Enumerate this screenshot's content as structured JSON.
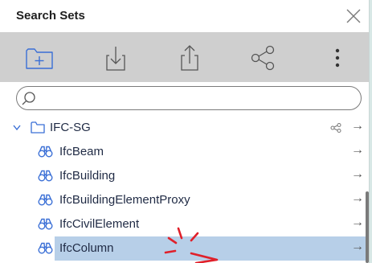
{
  "window": {
    "title": "Search Sets"
  },
  "toolbar": {
    "buttons": [
      {
        "name": "new-folder",
        "icon": "folder-plus-icon"
      },
      {
        "name": "import",
        "icon": "import-icon"
      },
      {
        "name": "export",
        "icon": "export-icon"
      },
      {
        "name": "share",
        "icon": "share-icon"
      },
      {
        "name": "more",
        "icon": "more-vertical-icon"
      }
    ]
  },
  "search": {
    "placeholder": "",
    "value": ""
  },
  "tree": {
    "folder": {
      "label": "IFC-SG",
      "expanded": true
    },
    "items": [
      {
        "label": "IfcBeam",
        "selected": false
      },
      {
        "label": "IfcBuilding",
        "selected": false
      },
      {
        "label": "IfcBuildingElementProxy",
        "selected": false
      },
      {
        "label": "IfcCivilElement",
        "selected": false
      },
      {
        "label": "IfcColumn",
        "selected": true
      }
    ],
    "arrow_glyph": "→"
  },
  "colors": {
    "toolbar_bg": "#cfcfcf",
    "icon_blue": "#3a6fd6",
    "selection": "#b7cfe8",
    "cursor_red": "#e0202a"
  }
}
